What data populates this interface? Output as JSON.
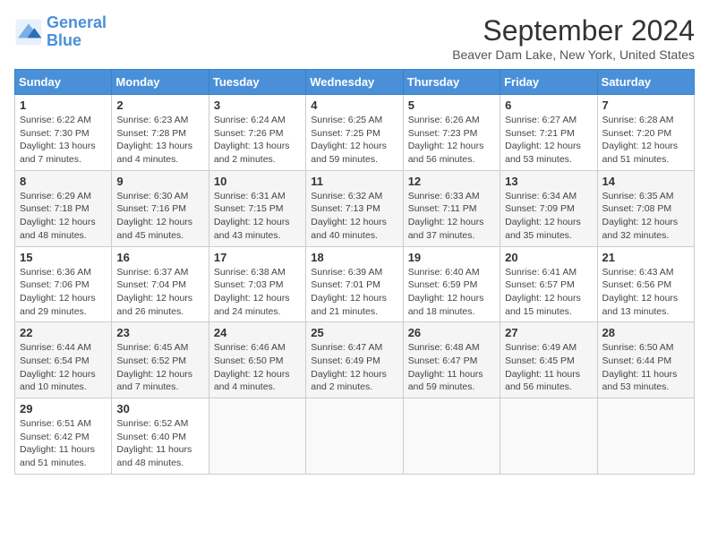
{
  "logo": {
    "line1": "General",
    "line2": "Blue"
  },
  "title": "September 2024",
  "subtitle": "Beaver Dam Lake, New York, United States",
  "days_header": [
    "Sunday",
    "Monday",
    "Tuesday",
    "Wednesday",
    "Thursday",
    "Friday",
    "Saturday"
  ],
  "weeks": [
    [
      {
        "day": "1",
        "info": "Sunrise: 6:22 AM\nSunset: 7:30 PM\nDaylight: 13 hours\nand 7 minutes."
      },
      {
        "day": "2",
        "info": "Sunrise: 6:23 AM\nSunset: 7:28 PM\nDaylight: 13 hours\nand 4 minutes."
      },
      {
        "day": "3",
        "info": "Sunrise: 6:24 AM\nSunset: 7:26 PM\nDaylight: 13 hours\nand 2 minutes."
      },
      {
        "day": "4",
        "info": "Sunrise: 6:25 AM\nSunset: 7:25 PM\nDaylight: 12 hours\nand 59 minutes."
      },
      {
        "day": "5",
        "info": "Sunrise: 6:26 AM\nSunset: 7:23 PM\nDaylight: 12 hours\nand 56 minutes."
      },
      {
        "day": "6",
        "info": "Sunrise: 6:27 AM\nSunset: 7:21 PM\nDaylight: 12 hours\nand 53 minutes."
      },
      {
        "day": "7",
        "info": "Sunrise: 6:28 AM\nSunset: 7:20 PM\nDaylight: 12 hours\nand 51 minutes."
      }
    ],
    [
      {
        "day": "8",
        "info": "Sunrise: 6:29 AM\nSunset: 7:18 PM\nDaylight: 12 hours\nand 48 minutes."
      },
      {
        "day": "9",
        "info": "Sunrise: 6:30 AM\nSunset: 7:16 PM\nDaylight: 12 hours\nand 45 minutes."
      },
      {
        "day": "10",
        "info": "Sunrise: 6:31 AM\nSunset: 7:15 PM\nDaylight: 12 hours\nand 43 minutes."
      },
      {
        "day": "11",
        "info": "Sunrise: 6:32 AM\nSunset: 7:13 PM\nDaylight: 12 hours\nand 40 minutes."
      },
      {
        "day": "12",
        "info": "Sunrise: 6:33 AM\nSunset: 7:11 PM\nDaylight: 12 hours\nand 37 minutes."
      },
      {
        "day": "13",
        "info": "Sunrise: 6:34 AM\nSunset: 7:09 PM\nDaylight: 12 hours\nand 35 minutes."
      },
      {
        "day": "14",
        "info": "Sunrise: 6:35 AM\nSunset: 7:08 PM\nDaylight: 12 hours\nand 32 minutes."
      }
    ],
    [
      {
        "day": "15",
        "info": "Sunrise: 6:36 AM\nSunset: 7:06 PM\nDaylight: 12 hours\nand 29 minutes."
      },
      {
        "day": "16",
        "info": "Sunrise: 6:37 AM\nSunset: 7:04 PM\nDaylight: 12 hours\nand 26 minutes."
      },
      {
        "day": "17",
        "info": "Sunrise: 6:38 AM\nSunset: 7:03 PM\nDaylight: 12 hours\nand 24 minutes."
      },
      {
        "day": "18",
        "info": "Sunrise: 6:39 AM\nSunset: 7:01 PM\nDaylight: 12 hours\nand 21 minutes."
      },
      {
        "day": "19",
        "info": "Sunrise: 6:40 AM\nSunset: 6:59 PM\nDaylight: 12 hours\nand 18 minutes."
      },
      {
        "day": "20",
        "info": "Sunrise: 6:41 AM\nSunset: 6:57 PM\nDaylight: 12 hours\nand 15 minutes."
      },
      {
        "day": "21",
        "info": "Sunrise: 6:43 AM\nSunset: 6:56 PM\nDaylight: 12 hours\nand 13 minutes."
      }
    ],
    [
      {
        "day": "22",
        "info": "Sunrise: 6:44 AM\nSunset: 6:54 PM\nDaylight: 12 hours\nand 10 minutes."
      },
      {
        "day": "23",
        "info": "Sunrise: 6:45 AM\nSunset: 6:52 PM\nDaylight: 12 hours\nand 7 minutes."
      },
      {
        "day": "24",
        "info": "Sunrise: 6:46 AM\nSunset: 6:50 PM\nDaylight: 12 hours\nand 4 minutes."
      },
      {
        "day": "25",
        "info": "Sunrise: 6:47 AM\nSunset: 6:49 PM\nDaylight: 12 hours\nand 2 minutes."
      },
      {
        "day": "26",
        "info": "Sunrise: 6:48 AM\nSunset: 6:47 PM\nDaylight: 11 hours\nand 59 minutes."
      },
      {
        "day": "27",
        "info": "Sunrise: 6:49 AM\nSunset: 6:45 PM\nDaylight: 11 hours\nand 56 minutes."
      },
      {
        "day": "28",
        "info": "Sunrise: 6:50 AM\nSunset: 6:44 PM\nDaylight: 11 hours\nand 53 minutes."
      }
    ],
    [
      {
        "day": "29",
        "info": "Sunrise: 6:51 AM\nSunset: 6:42 PM\nDaylight: 11 hours\nand 51 minutes."
      },
      {
        "day": "30",
        "info": "Sunrise: 6:52 AM\nSunset: 6:40 PM\nDaylight: 11 hours\nand 48 minutes."
      },
      {
        "day": "",
        "info": ""
      },
      {
        "day": "",
        "info": ""
      },
      {
        "day": "",
        "info": ""
      },
      {
        "day": "",
        "info": ""
      },
      {
        "day": "",
        "info": ""
      }
    ]
  ]
}
